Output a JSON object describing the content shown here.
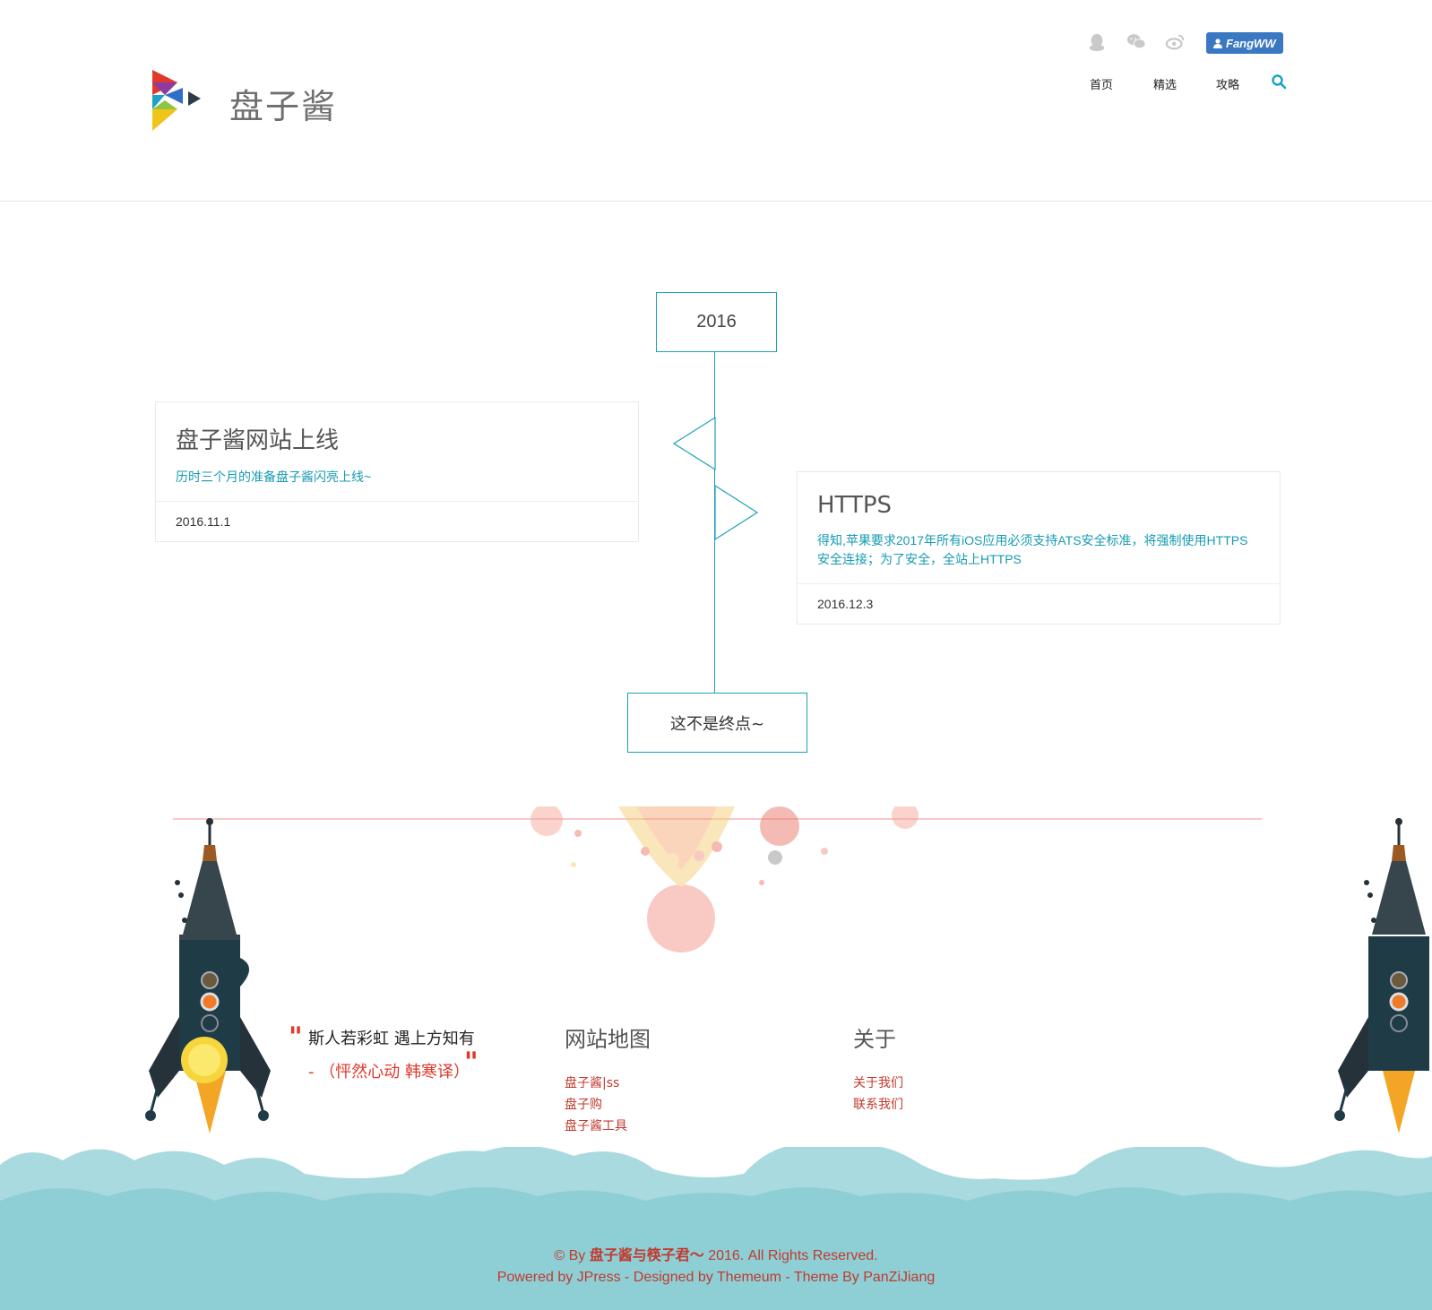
{
  "brand": {
    "name": "盘子酱",
    "logo_icon": "play-triangles-logo-icon"
  },
  "social": [
    {
      "icon": "qq-icon"
    },
    {
      "icon": "wechat-icon"
    },
    {
      "icon": "weibo-icon"
    }
  ],
  "user": {
    "name": "FangWW",
    "icon": "user-icon"
  },
  "nav": {
    "items": [
      "首页",
      "精选",
      "攻略"
    ],
    "search_icon": "search-icon"
  },
  "timeline": {
    "year": "2016",
    "entries": [
      {
        "title": "盘子酱网站上线",
        "desc": "历时三个月的准备盘子酱闪亮上线~",
        "date": "2016.11.1"
      },
      {
        "title": "HTTPS",
        "desc": "得知,苹果要求2017年所有iOS应用必须支持ATS安全标准，将强制使用HTTPS安全连接；为了安全，全站上HTTPS",
        "date": "2016.12.3"
      }
    ],
    "end_label": "这不是终点~"
  },
  "footer": {
    "quote": {
      "text": "斯人若彩虹 遇上方知有",
      "author": "- （怦然心动 韩寒译）"
    },
    "sitemap": {
      "title": "网站地图",
      "links": [
        "盘子酱|ss",
        "盘子购",
        "盘子酱工具"
      ]
    },
    "about": {
      "title": "关于",
      "links": [
        "关于我们",
        "联系我们"
      ]
    },
    "copyright_prefix": "© By ",
    "copyright_owner": "盘子酱与筷子君～",
    "copyright_suffix": " 2016. All Rights Reserved.",
    "powered": "Powered by JPress - Designed by Themeum - Theme By PanZiJiang"
  },
  "colors": {
    "accent": "#1ba1b8",
    "link": "#c13a2e",
    "badge": "#3b78c2",
    "cloud": "#8ecfd6"
  }
}
